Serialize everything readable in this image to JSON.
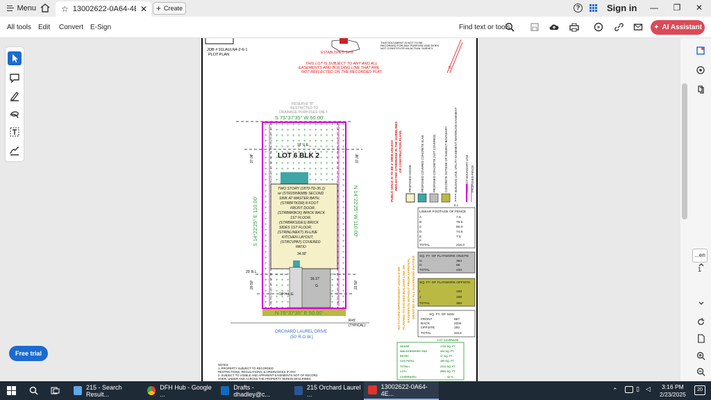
{
  "titlebar": {
    "menu_label": "Menu",
    "doc_tab_title": "13002622-0A64-4EE6-9...",
    "new_tab_label": "Create",
    "sign_in_label": "Sign in"
  },
  "toolbar": {
    "items": [
      "All tools",
      "Edit",
      "Convert",
      "E-Sign"
    ],
    "find_label": "Find text or tools",
    "ai_label": "AI Assistant"
  },
  "free_trial_label": "Free trial",
  "page_indicator": {
    "box": "...en",
    "current": "1"
  },
  "plan": {
    "job": "JOB # 91LAULN4-2-6-1",
    "plot_plan": "PLOT PLAN",
    "established": "ESTABLISHED 1978",
    "disclaimer": [
      "THIS DOCUMENT IS NOT TO BE",
      "RECORDED FOR ANY PURPOSE AND DOES",
      "NOT CONSTITUTE AN ACTUAL SURVEY."
    ],
    "easement_note": [
      "THIS LOT IS SUBJECT TO ANY AND ALL",
      "EASEMENTS AND BUILDING LINE THAT ARE",
      "NOT REFLECTED ON THE RECORDED PLAT."
    ],
    "reserve": [
      "RESERVE \"B\"",
      "RESTRICTED TO",
      "DRAINAGE PURPOSES ONLY"
    ],
    "top_bearing": "S 75°37'35\" W 50.00'",
    "bottom_bearing": "N 75°37'35\" E 50.00'",
    "left_bearing": "S 14°22'25\" E 110.00'",
    "right_bearing": "N 14°22'25\" W 110.00'",
    "lot_label": "LOT 6 BLK 2",
    "ue_label": "16' U.E.",
    "house_text": [
      "TWO STORY (1870-TD-35.1)",
      "w/ (STR25INKMB) SECOND",
      "SINK AT MASTER BATH,",
      "(STRBFTKDR) 8 FOOT",
      "FRONT DOOR,",
      "(STRBRKBCK) BRICK BACK",
      "1ST FLOOR,",
      "(STRBRKSIDE1) BRICK",
      "SIDES 1ST FLOOR,",
      "(STRINLINEKT) IN-LINE",
      "KITCHEN LAYOUT,",
      "(STRCVPAT) COVERED",
      "PATIO"
    ],
    "dim_34": "34.92'",
    "dim_16": "16.17'",
    "dim_37_left": "37.08'",
    "dim_37_right": "37.08'",
    "dim_2250": "22.50'",
    "dim_2050": "20.50'",
    "dim_20bl": "20' B.L.",
    "le_label": "10' H.L.E.",
    "street_name": "ORCHARD LAUREL DRIVE",
    "row_label": "(50' R.O.W.)",
    "radius_label": "R=5'",
    "typical_label": "(TYPICAL)",
    "red_vertical_note": [
      "PUBLIC WALK IS TO BE 4' WIDE UNLESS",
      "REFLECTED OTHERWISE IN THE GUIDELINES",
      "OR CONSTRUCTION PLANS."
    ],
    "orange_vertical_note": [
      "NO FUTURE IMPROVEMENT SHOULD BE",
      "PLANNED TO EXCEED BUILDING LINE OR",
      "EASEMENTS WITHOUT PRIOR APPROVAL",
      "GRANTED BY ALL GOVERNING ENTITIES."
    ],
    "legend_labels": [
      "PROPOSED HOUSE",
      "PROPOSED COVERED CONCRETE SLAB",
      "PROPOSED CONCRETE (NOT COVERED)",
      "CONCRETE OUTSIDE OF SUBJECT BOUNDARY",
      "BUILDING LINE, UTILITY EASEMENT, WATERLINE EASEMENT",
      "SUBJECT BOUNDARY LINE",
      "PROPOSED FENCE"
    ],
    "legend_short": [
      "B.L.",
      "U.E.",
      "W.L.E."
    ],
    "fence_table": {
      "title": "LINEAR FOOTAGE OF FENCE",
      "rows": [
        [
          "A",
          "7.5"
        ],
        [
          "B",
          "76.5"
        ],
        [
          "C",
          "50.0"
        ],
        [
          "D",
          "74.5"
        ],
        [
          "E",
          "7.5"
        ],
        [
          "F",
          ""
        ]
      ],
      "total": [
        "TOTAL",
        "216.0"
      ]
    },
    "onsite_table": {
      "title": "SQ. FT. OF FLATWORK ONSITE",
      "rows": [
        [
          "G",
          "364"
        ],
        [
          "H",
          "69"
        ]
      ],
      "total": [
        "TOTAL",
        "433"
      ]
    },
    "offsite_table": {
      "title": "SQ. FT. OF FLATWORK OFFSITE",
      "rows": [
        [
          "I",
          "169"
        ],
        [
          "J",
          "189"
        ]
      ],
      "total": [
        "TOTAL",
        "358"
      ]
    },
    "sod_table": {
      "title": "SQ. FT. OF SOD",
      "rows": [
        [
          "FRONT",
          "887"
        ],
        [
          "BACK",
          "2334"
        ],
        [
          "OFFSITE",
          "192"
        ]
      ],
      "total": [
        "TOTAL",
        "3413"
      ]
    },
    "coverage_table": {
      "title": "LOT COVERAGE",
      "rows": [
        [
          "HOUSE",
          "1722 SQ. FT."
        ],
        [
          "WALK/DRIVE/RC PAD",
          "433 SQ. FT."
        ],
        [
          "ENTRY",
          "17 SQ. FT."
        ],
        [
          "COV PATIO",
          "150 SQ. FT."
        ],
        [
          "TOTAL=",
          "2312 SQ. FT."
        ],
        [
          "LOT=",
          "5500 SQ. FT."
        ],
        [
          "COVERAGE=",
          "42 %"
        ]
      ]
    },
    "notes": [
      "NOTES:",
      "1. PROPERTY SUBJECT TO RECORDED",
      "RESTRICTIONS, REGULATIONS, & ORDINANCES IF ANY.",
      "2. SUBJECT TO VISIBLE AND APPARENT EASEMENTS NOT OF RECORD",
      "OVER, UNDER AND ACROSS THE PROPERTY HEREIN DESCRIBED."
    ]
  },
  "taskbar": {
    "items": [
      {
        "label": "215 - Search Result..."
      },
      {
        "label": "DFH Hub - Google ..."
      },
      {
        "label": "Drafts - dhadley@c..."
      },
      {
        "label": "215 Orchard Laurel ..."
      },
      {
        "label": "13002622-0A64-4E..."
      }
    ],
    "time": "3:16 PM",
    "date": "2/23/2025",
    "badge": "20"
  },
  "colors": {
    "accent": "#dc4a57",
    "magenta": "#d400d4",
    "teal": "#3fa6a6",
    "olive": "#b9b944",
    "blue": "#1b6bd0"
  }
}
